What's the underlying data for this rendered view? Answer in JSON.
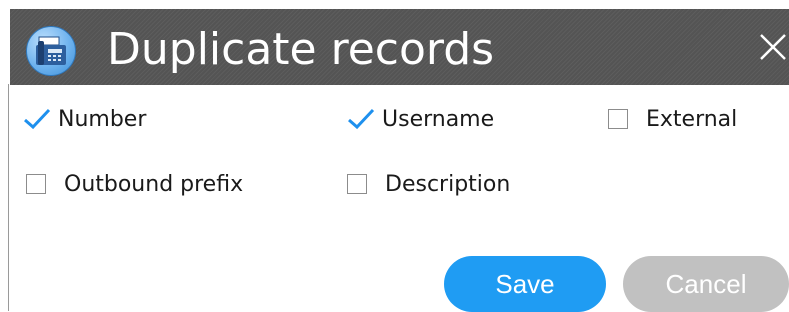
{
  "dialog": {
    "title": "Duplicate records",
    "icon": "fax-machine-icon",
    "close_icon": "close-icon"
  },
  "fields": [
    {
      "id": "number",
      "label": "Number",
      "checked": true
    },
    {
      "id": "username",
      "label": "Username",
      "checked": true
    },
    {
      "id": "external",
      "label": "External",
      "checked": false
    },
    {
      "id": "outbound_prefix",
      "label": "Outbound prefix",
      "checked": false
    },
    {
      "id": "description",
      "label": "Description",
      "checked": false
    }
  ],
  "buttons": {
    "save_label": "Save",
    "cancel_label": "Cancel"
  },
  "colors": {
    "titlebar": "#545454",
    "accent": "#1f9cf3",
    "cancel": "#c1c1c1",
    "check": "#1e90ee"
  }
}
